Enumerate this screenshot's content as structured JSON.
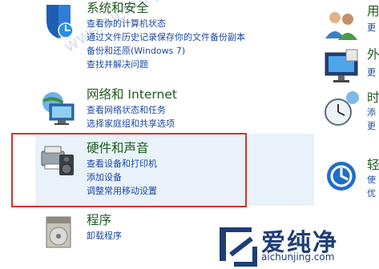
{
  "categories": {
    "system": {
      "title": "系统和安全",
      "links": [
        "查看你的计算机状态",
        "通过文件历史记录保存你的文件备份副本",
        "备份和还原(Windows 7)",
        "查找并解决问题"
      ]
    },
    "network": {
      "title": "网络和 Internet",
      "links": [
        "查看网络状态和任务",
        "选择家庭组和共享选项"
      ]
    },
    "hardware": {
      "title": "硬件和声音",
      "links": [
        "查看设备和打印机",
        "添加设备",
        "调整常用移动设置"
      ]
    },
    "programs": {
      "title": "程序",
      "links": [
        "卸载程序"
      ]
    }
  },
  "right": {
    "accounts": {
      "title": "用",
      "sub": "更"
    },
    "appearance": {
      "title": "外",
      "sub": "更"
    },
    "clock": {
      "title": "时",
      "sub1": "添",
      "sub2": "更"
    },
    "ease": {
      "title": "轻",
      "sub1": "使",
      "sub2": "优"
    }
  },
  "watermark": {
    "text": "爱纯净",
    "url": "aichunjing.com",
    "faint": "wws.aichunjing.com"
  }
}
